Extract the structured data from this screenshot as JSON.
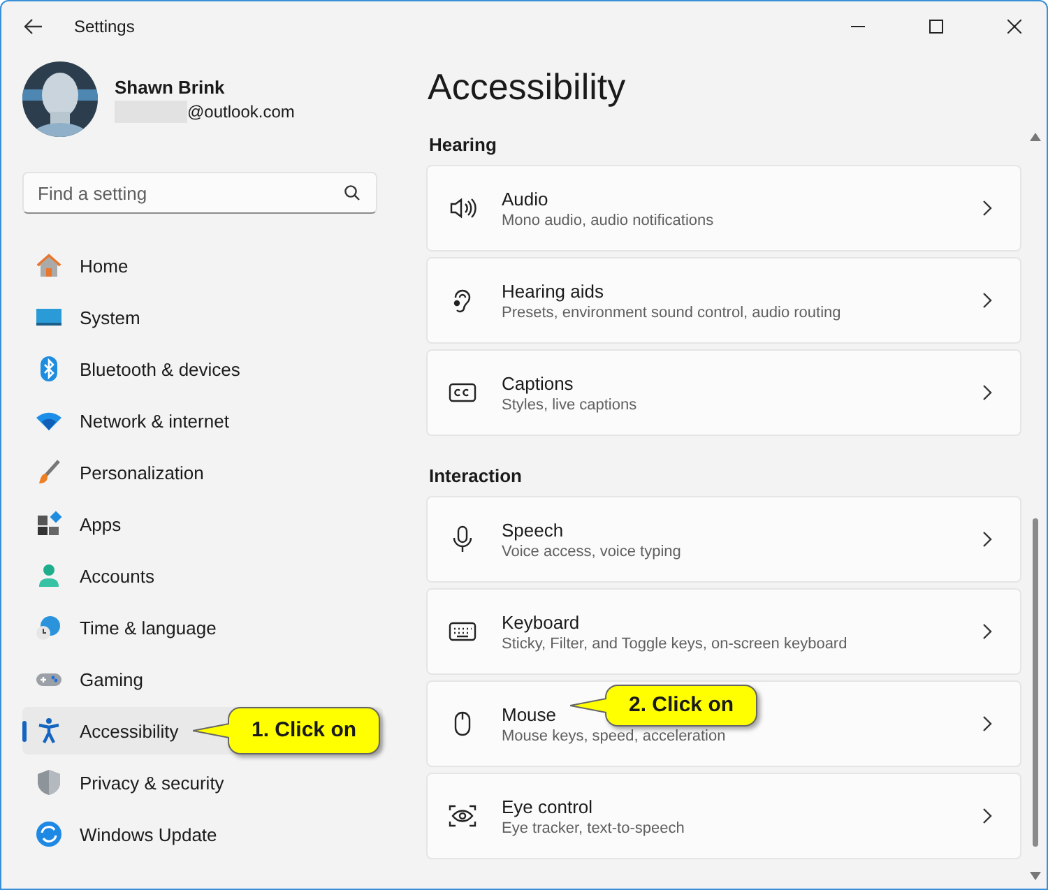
{
  "window": {
    "title": "Settings"
  },
  "account": {
    "name": "Shawn Brink",
    "email": "@outlook.com"
  },
  "search": {
    "placeholder": "Find a setting"
  },
  "nav": [
    {
      "label": "Home",
      "selected": false
    },
    {
      "label": "System",
      "selected": false
    },
    {
      "label": "Bluetooth & devices",
      "selected": false
    },
    {
      "label": "Network & internet",
      "selected": false
    },
    {
      "label": "Personalization",
      "selected": false
    },
    {
      "label": "Apps",
      "selected": false
    },
    {
      "label": "Accounts",
      "selected": false
    },
    {
      "label": "Time & language",
      "selected": false
    },
    {
      "label": "Gaming",
      "selected": false
    },
    {
      "label": "Accessibility",
      "selected": true,
      "callout": "1. Click on"
    },
    {
      "label": "Privacy & security",
      "selected": false
    },
    {
      "label": "Windows Update",
      "selected": false
    }
  ],
  "page": {
    "title": "Accessibility",
    "sections": [
      {
        "heading": "Hearing",
        "items": [
          {
            "title": "Audio",
            "subtitle": "Mono audio, audio notifications"
          },
          {
            "title": "Hearing aids",
            "subtitle": "Presets, environment sound control, audio routing"
          },
          {
            "title": "Captions",
            "subtitle": "Styles, live captions"
          }
        ]
      },
      {
        "heading": "Interaction",
        "items": [
          {
            "title": "Speech",
            "subtitle": "Voice access, voice typing"
          },
          {
            "title": "Keyboard",
            "subtitle": "Sticky, Filter, and Toggle keys, on-screen keyboard"
          },
          {
            "title": "Mouse",
            "subtitle": "Mouse keys, speed, acceleration",
            "callout": "2. Click on"
          },
          {
            "title": "Eye control",
            "subtitle": "Eye tracker, text-to-speech"
          }
        ]
      }
    ]
  }
}
